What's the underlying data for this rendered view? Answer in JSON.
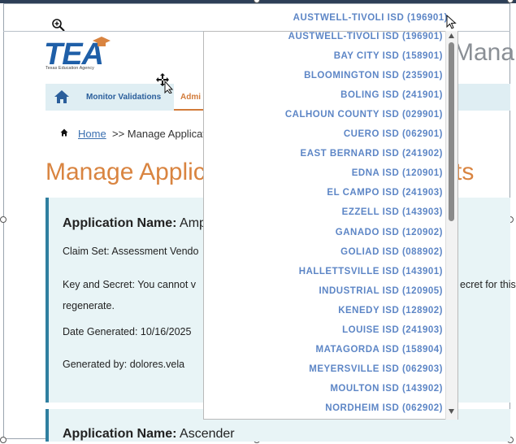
{
  "header": {
    "logo_text": "TEA",
    "logo_subtitle": "Texas Education Agency",
    "title_peek": "Mana"
  },
  "nav": {
    "monitor_label": "Monitor Validations",
    "admin_label": "Admi"
  },
  "breadcrumb": {
    "home_label": "Home",
    "rest": ">> Manage Applicat"
  },
  "page": {
    "title_left": "Manage Applic",
    "title_right": "ts"
  },
  "card1": {
    "app_name_label": "Application Name:",
    "app_name_value": "Amp",
    "claim_set": "Claim Set: Assessment Vendo",
    "key_secret_line1_label": "Key and Secret:",
    "key_secret_line1_text": "You cannot v",
    "key_secret_right": "ecret for this",
    "key_secret_line2": "regenerate.",
    "date_generated": "Date Generated: 10/16/2025",
    "generated_by": "Generated by: dolores.vela"
  },
  "card2": {
    "app_name_label": "Application Name:",
    "app_name_value": "Ascender"
  },
  "dropdown": {
    "selected": "AUSTWELL-TIVOLI ISD (196901)",
    "options": [
      "AUSTWELL-TIVOLI ISD (196901)",
      "BAY CITY ISD (158901)",
      "BLOOMINGTON ISD (235901)",
      "BOLING ISD (241901)",
      "CALHOUN COUNTY ISD (029901)",
      "CUERO ISD (062901)",
      "EAST BERNARD ISD (241902)",
      "EDNA ISD (120901)",
      "EL CAMPO ISD (241903)",
      "EZZELL ISD (143903)",
      "GANADO ISD (120902)",
      "GOLIAD ISD (088902)",
      "HALLETTSVILLE ISD (143901)",
      "INDUSTRIAL ISD (120905)",
      "KENEDY ISD (128902)",
      "LOUISE ISD (241903)",
      "MATAGORDA ISD (158904)",
      "MEYERSVILLE ISD (062903)",
      "MOULTON ISD (143902)",
      "NORDHEIM ISD (062902)"
    ]
  },
  "colors": {
    "accent_orange": "#d98440",
    "brand_blue": "#1f5fa8",
    "dropdown_text": "#5d86c6",
    "card_border": "#2f7fa0"
  }
}
